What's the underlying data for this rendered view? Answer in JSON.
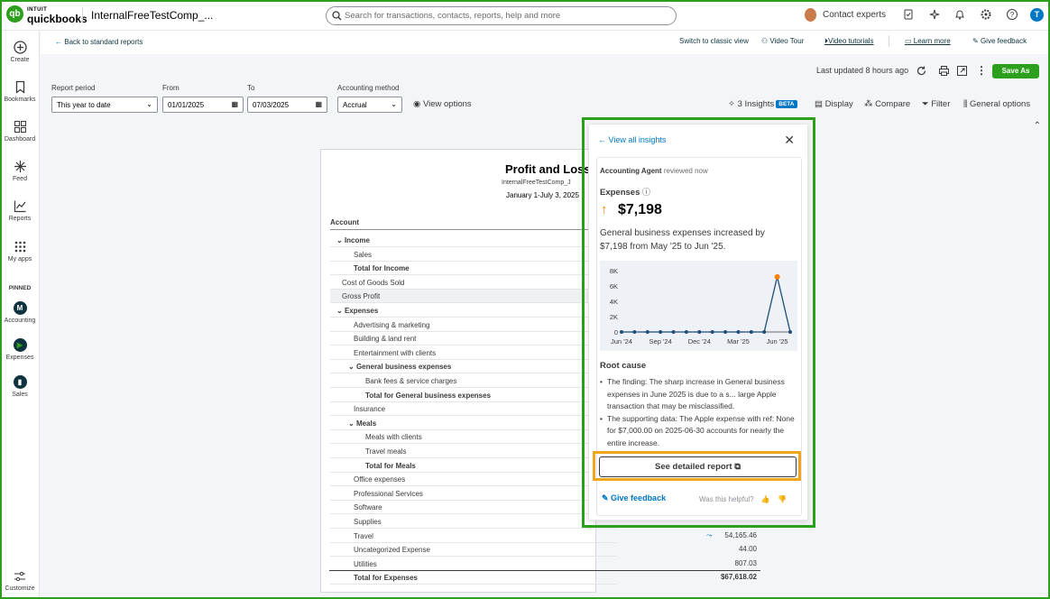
{
  "app": {
    "brand_top": "INTUIT",
    "brand_name": "quickbooks",
    "company": "InternalFreeTestComp_...",
    "user_initial": "T"
  },
  "search": {
    "placeholder": "Search for transactions, contacts, reports, help and more"
  },
  "topbar": {
    "contact_experts": "Contact experts"
  },
  "nav": {
    "items": [
      {
        "label": "Create"
      },
      {
        "label": "Bookmarks"
      },
      {
        "label": "Dashboard"
      },
      {
        "label": "Feed"
      },
      {
        "label": "Reports"
      },
      {
        "label": "My apps"
      }
    ],
    "pinned_label": "PINNED",
    "pinned": [
      {
        "label": "Accounting",
        "letter": "M"
      },
      {
        "label": "Expenses"
      },
      {
        "label": "Sales"
      }
    ],
    "customize": "Customize"
  },
  "subheader": {
    "back": "Back to standard reports",
    "switch": "Switch to classic view",
    "video_tour": "Video Tour",
    "video_tutorials": "Video tutorials",
    "learn_more": "Learn more",
    "give_feedback": "Give feedback"
  },
  "toolbar": {
    "last_updated": "Last updated 8 hours ago",
    "save_as": "Save As"
  },
  "filters": {
    "report_period_label": "Report period",
    "report_period": "This year to date",
    "from_label": "From",
    "from": "01/01/2025",
    "to_label": "To",
    "to": "07/03/2025",
    "method_label": "Accounting method",
    "method": "Accrual",
    "view_options": "View options",
    "insights": "3 Insights",
    "beta": "BETA",
    "display": "Display",
    "compare": "Compare",
    "filter": "Filter",
    "general_options": "General options"
  },
  "report": {
    "title": "Profit and Loss",
    "company": "InternalFreeTestComp_J",
    "period": "January 1-July 3, 2025",
    "account_header": "Account",
    "rows": [
      {
        "label": "Income",
        "indent": 1,
        "bold": true,
        "chev": true
      },
      {
        "label": "Sales",
        "indent": 2
      },
      {
        "label": "Total for Income",
        "indent": 2,
        "bold": true
      },
      {
        "label": "Cost of Goods Sold",
        "indent": 0
      },
      {
        "label": "Gross Profit",
        "indent": 0,
        "shade": true
      },
      {
        "label": "Expenses",
        "indent": 1,
        "bold": true,
        "chev": true
      },
      {
        "label": "Advertising & marketing",
        "indent": 2
      },
      {
        "label": "Building & land rent",
        "indent": 2
      },
      {
        "label": "Entertainment with clients",
        "indent": 2
      },
      {
        "label": "General business expenses",
        "indent": 3,
        "bold": true,
        "chev": true
      },
      {
        "label": "Bank fees & service charges",
        "indent": 4
      },
      {
        "label": "Total for General business expenses",
        "indent": 4,
        "bold": true
      },
      {
        "label": "Insurance",
        "indent": 2
      },
      {
        "label": "Meals",
        "indent": 3,
        "bold": true,
        "chev": true
      },
      {
        "label": "Meals with clients",
        "indent": 4
      },
      {
        "label": "Travel meals",
        "indent": 4
      },
      {
        "label": "Total for Meals",
        "indent": 4,
        "bold": true
      },
      {
        "label": "Office expenses",
        "indent": 2
      },
      {
        "label": "Professional Services",
        "indent": 2
      },
      {
        "label": "Software",
        "indent": 2
      },
      {
        "label": "Supplies",
        "indent": 2
      },
      {
        "label": "Travel",
        "indent": 2,
        "amount": "54,165.46"
      },
      {
        "label": "Uncategorized Expense",
        "indent": 2,
        "amount": "44.00"
      },
      {
        "label": "Utilities",
        "indent": 2,
        "amount": "807.03"
      },
      {
        "label": "Total for Expenses",
        "indent": 2,
        "bold": true,
        "amount": "$67,618.02"
      }
    ]
  },
  "insight": {
    "view_all": "View all insights",
    "agent": "Accounting Agent",
    "reviewed": "reviewed now",
    "metric": "Expenses",
    "amount": "$7,198",
    "description": "General business expenses increased by $7,198 from May '25 to Jun '25.",
    "root_cause": "Root cause",
    "bullets": [
      "The finding: The sharp increase in General business expenses in June 2025 is due to a s... large Apple transaction that may be misclassified.",
      "The supporting data: The Apple expense with ref: None for $7,000.00 on 2025-06-30 accounts for nearly the entire increase."
    ],
    "detail_button": "See detailed report",
    "give_feedback": "Give feedback",
    "helpful": "Was this helpful?"
  },
  "chart_data": {
    "type": "line",
    "x": [
      "Jun '24",
      "Jul '24",
      "Aug '24",
      "Sep '24",
      "Oct '24",
      "Nov '24",
      "Dec '24",
      "Jan '25",
      "Feb '25",
      "Mar '25",
      "Apr '25",
      "May '25",
      "Jun '25",
      "Jul '25"
    ],
    "tick_labels": [
      "Jun '24",
      "Sep '24",
      "Dec '24",
      "Mar '25",
      "Jun '25"
    ],
    "values": [
      0,
      0,
      0,
      0,
      0,
      0,
      0,
      0,
      0,
      0,
      0,
      0,
      7198,
      0
    ],
    "highlight_index": 12,
    "yticks": [
      "0",
      "2K",
      "4K",
      "6K",
      "8K"
    ],
    "ylim": [
      0,
      8000
    ],
    "colors": {
      "line": "#1f4e79",
      "highlight": "#ff8000"
    }
  }
}
